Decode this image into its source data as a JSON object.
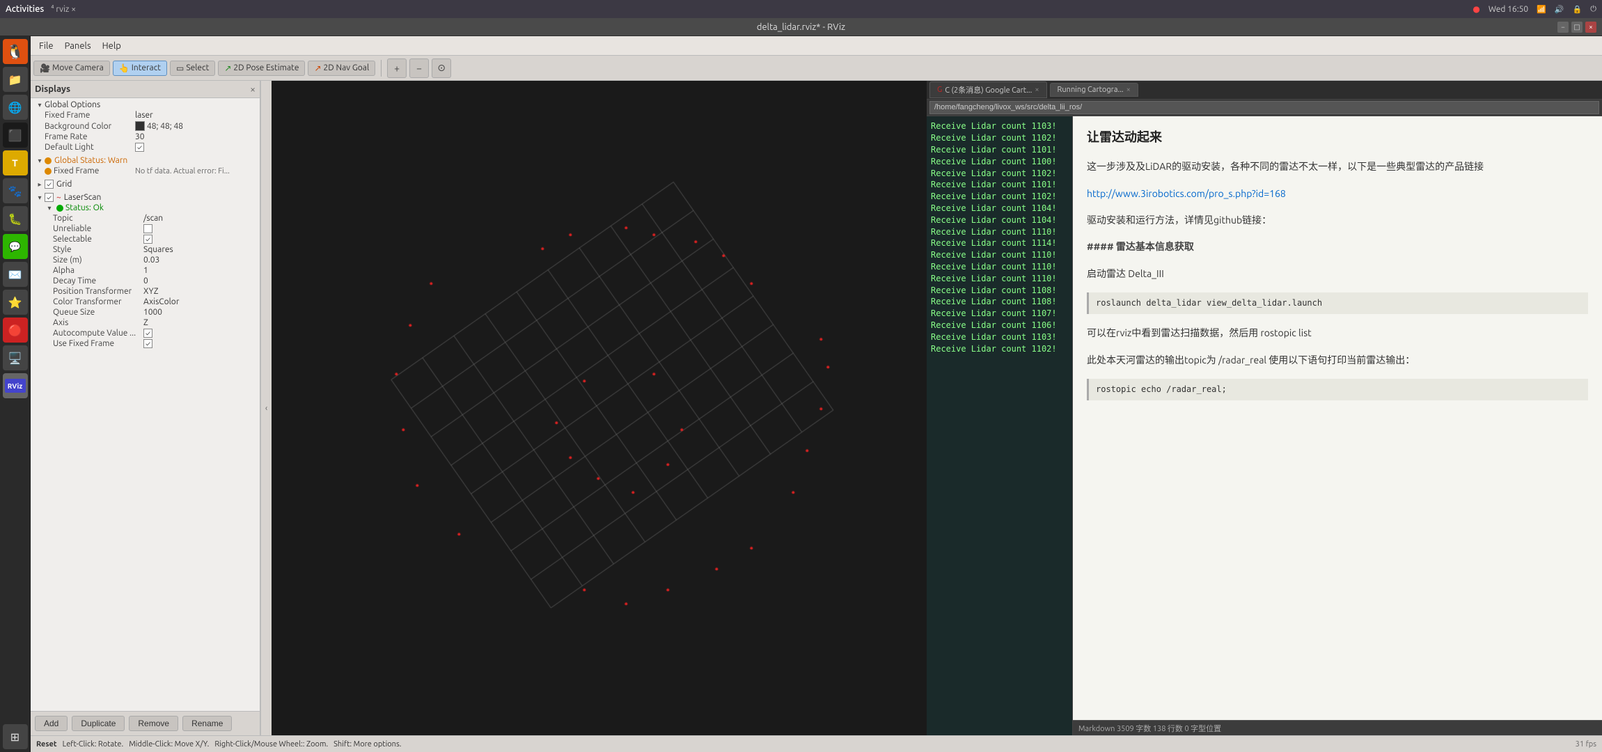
{
  "system_bar": {
    "activities": "Activities",
    "rviz_label": "⁴ rviz ×",
    "time": "Wed 16:50",
    "recording_dot": "●"
  },
  "window_title": "delta_lidar.rviz* - RViz",
  "menu": {
    "file": "File",
    "panels": "Panels",
    "help": "Help"
  },
  "toolbar": {
    "move_camera": "Move Camera",
    "interact": "Interact",
    "select": "Select",
    "pose_estimate": "2D Pose Estimate",
    "nav_goal": "2D Nav Goal",
    "plus_icon": "+",
    "minus_icon": "−",
    "camera_icon": "⊙"
  },
  "displays_panel": {
    "title": "Displays",
    "global_options_label": "Global Options",
    "fixed_frame_label": "Fixed Frame",
    "fixed_frame_value": "laser",
    "background_color_label": "Background Color",
    "background_color_value": "48; 48; 48",
    "frame_rate_label": "Frame Rate",
    "frame_rate_value": "30",
    "default_light_label": "Default Light",
    "default_light_value": "✓",
    "global_status_label": "Global Status: Warn",
    "fixed_frame_warn_label": "Fixed Frame",
    "fixed_frame_warn_value": "No tf data. Actual error: Fi...",
    "grid_label": "Grid",
    "grid_value": "✓",
    "laser_scan_label": "LaserScan",
    "laser_scan_value": "✓",
    "status_ok": "Status: Ok",
    "topic_label": "Topic",
    "topic_value": "/scan",
    "unreliable_label": "Unreliable",
    "unreliable_value": "",
    "selectable_label": "Selectable",
    "selectable_value": "✓",
    "style_label": "Style",
    "style_value": "Squares",
    "size_label": "Size (m)",
    "size_value": "0.03",
    "alpha_label": "Alpha",
    "alpha_value": "1",
    "decay_time_label": "Decay Time",
    "decay_time_value": "0",
    "position_transformer_label": "Position Transformer",
    "position_transformer_value": "XYZ",
    "color_transformer_label": "Color Transformer",
    "color_transformer_value": "AxisColor",
    "queue_size_label": "Queue Size",
    "queue_size_value": "1000",
    "axis_label": "Axis",
    "axis_value": "Z",
    "autocompute_label": "Autocompute Value ...",
    "autocompute_value": "✓",
    "use_fixed_frame_label": "Use Fixed Frame",
    "use_fixed_frame_value": "✓"
  },
  "bottom_buttons": {
    "add": "Add",
    "duplicate": "Duplicate",
    "remove": "Remove",
    "rename": "Rename"
  },
  "status_bar": {
    "reset": "Reset",
    "left_click": "Left-Click: Rotate.",
    "middle_click": "Middle-Click: Move X/Y.",
    "right_click": "Right-Click/Mouse Wheel:: Zoom.",
    "shift": "Shift: More options.",
    "fps": "31 fps"
  },
  "browser_tabs": [
    {
      "label": "C (2条消息) Google Cart...",
      "active": false,
      "close": "×"
    },
    {
      "label": "Running Cartogra...",
      "active": true,
      "close": "×"
    }
  ],
  "address_bar": {
    "value": "/home/fangcheng/livox_ws/src/delta_lii_ros/"
  },
  "terminal_lines": [
    "Receive Lidar count 1103!",
    "Receive Lidar count 1102!",
    "Receive Lidar count 1101!",
    "Receive Lidar count 1100!",
    "Receive Lidar count 1102!",
    "Receive Lidar count 1101!",
    "Receive Lidar count 1102!",
    "Receive Lidar count 1104!",
    "Receive Lidar count 1104!",
    "Receive Lidar count 1110!",
    "Receive Lidar count 1114!",
    "Receive Lidar count 1110!",
    "Receive Lidar count 1110!",
    "Receive Lidar count 1110!",
    "Receive Lidar count 1108!",
    "Receive Lidar count 1108!",
    "Receive Lidar count 1107!",
    "Receive Lidar count 1106!",
    "Receive Lidar count 1103!",
    "Receive Lidar count 1102!"
  ],
  "right_content": {
    "heading1": "让雷达动起来",
    "section1_text": "这一步涉及及LiDAR的驱动安装，各种不同的雷达不太一样，以下是一些典型雷达的产品链接",
    "link1": "http://www.3irobotics.com/pro_s.php?id=168",
    "section2_text": "驱动安装和运行方法，详情见github链接：",
    "heading2": "#### 雷达基本信息获取",
    "section3_text": "启动雷达 Delta_III",
    "code1": "roslaunch delta_lidar view_delta_lidar.launch",
    "section4_text": "可以在rviz中看到雷达扫描数据，然后用 rostopic list",
    "section5_text": "此处本天河雷达的输出topic为 /radar_real 使用以下语句打印当前雷达输出：",
    "code2": "rostopic echo /radar_real;"
  },
  "markdown_status": "Markdown  3509 字数 138 行数 0 字型位置"
}
